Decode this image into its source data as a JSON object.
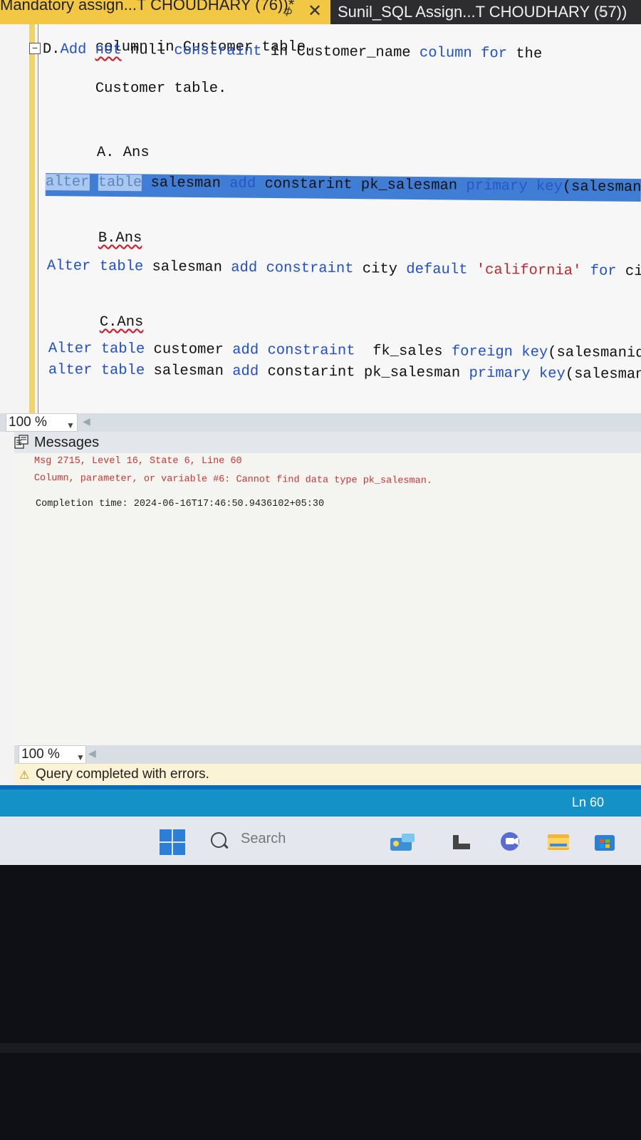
{
  "tabs": {
    "active_title": "Mandatory assign...T CHOUDHARY (76))*",
    "pin": "⊅",
    "close": "✕",
    "inactive_title": "Sunil_SQL Assign...T CHOUDHARY (57))"
  },
  "editor": {
    "lines": {
      "l1": "column in Customer table.",
      "l2_prefix": "D.",
      "l3": "Customer table.",
      "a_ans": "A. Ans",
      "b_ans": "B.Ans",
      "c_ans": "C.Ans"
    },
    "tokens": {
      "add": "Add",
      "not": "not",
      "null": "null",
      "constraint": "constraint",
      "in": "in",
      "customer_name": "Customer_name",
      "column": "column",
      "for": "for",
      "the": "the"
    },
    "selected_line": {
      "alter": "alter",
      "table": "table",
      "salesman": "salesman",
      "add": "add",
      "constarint": "constarint",
      "pk": "pk_salesman",
      "primary": "primary",
      "key": "key",
      "rest": "(salesmani"
    },
    "b_line": {
      "alter": "Alter",
      "table": "table",
      "salesman": "salesman",
      "add": "add",
      "constraint": "constraint",
      "city": "city",
      "default": "default",
      "literal": "'california'",
      "for": "for",
      "rest": "cit"
    },
    "c_line1": {
      "alter": "Alter",
      "table": "table",
      "customer": "customer",
      "add": "add",
      "constraint": "constraint",
      "fk": "fk_sales",
      "foreign": "foreign",
      "key": "key",
      "rest": "(salesmanid)"
    },
    "c_line2": {
      "alter": "alter",
      "table": "table",
      "salesman": "salesman",
      "add": "add",
      "constarint": "constarint",
      "pk": "pk_salesman",
      "primary": "primary",
      "key": "key",
      "rest": "(salesmanid"
    }
  },
  "zoom": {
    "editor_zoom": "100 %",
    "results_zoom": "100 %"
  },
  "results": {
    "tab_label": "Messages",
    "error_line1": "Msg 2715, Level 16, State 6, Line 60",
    "error_line2": "Column, parameter, or variable #6: Cannot find data type pk_salesman.",
    "completion": "Completion time: 2024-06-16T17:46:50.9436102+05:30"
  },
  "status": {
    "query_status": "Query completed with errors.",
    "line_number": "Ln 60"
  },
  "taskbar": {
    "search_placeholder": "Search"
  },
  "colors": {
    "active_tab": "#f2c744",
    "keyword_blue": "#1f4fd0",
    "string_red": "#c0272d",
    "selection": "#3f7ed4",
    "status_bar": "#1491c6",
    "error_text": "#cc3333"
  }
}
